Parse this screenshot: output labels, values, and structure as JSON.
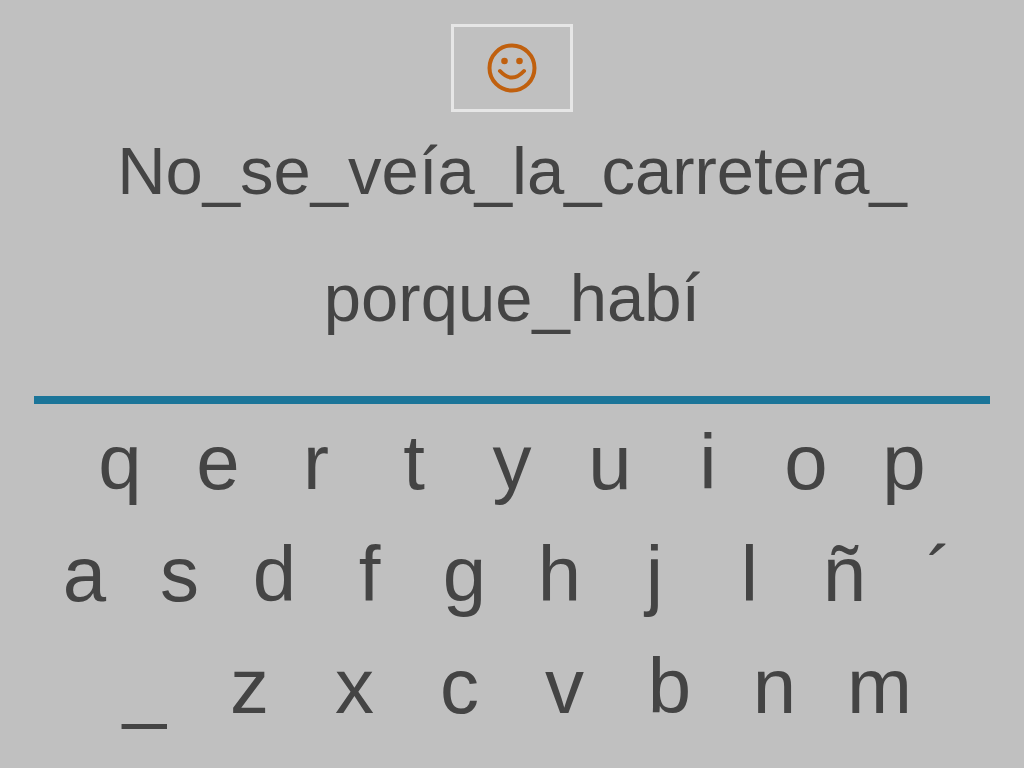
{
  "sentence_lines": [
    "No_se_veía_la_carretera_",
    "porque_habí"
  ],
  "keyboard": {
    "rows": [
      [
        "q",
        "e",
        "r",
        "t",
        "y",
        "u",
        "i",
        "o",
        "p"
      ],
      [
        "a",
        "s",
        "d",
        "f",
        "g",
        "h",
        "j",
        "l",
        "ñ",
        "´"
      ],
      [
        "_",
        "z",
        "x",
        "c",
        "v",
        "b",
        "n",
        "m"
      ]
    ]
  }
}
